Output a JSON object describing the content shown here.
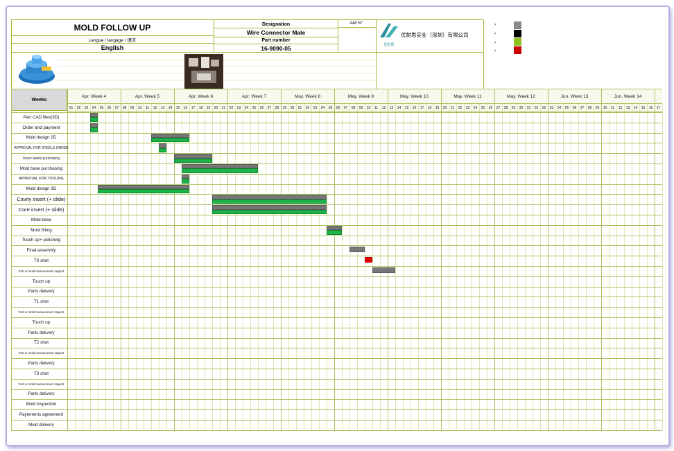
{
  "header": {
    "title": "MOLD FOLLOW UP",
    "language_label": "Langue / langage / 语言",
    "language_value": "English",
    "designation_label": "Designation",
    "designation_value": "Wire Connector Male",
    "am_label": "AM N°",
    "part_number_label": "Part number",
    "part_number_value": "16-9090-05",
    "company_name": "优耐思实业（深圳）有限公司",
    "logo_caption": "优耐思"
  },
  "legend": {
    "colors": [
      "#888888",
      "#000000",
      "#8dc21f",
      "#cc0000"
    ]
  },
  "schedule": {
    "weeks_label": "Weeks",
    "weeks": [
      "Apr.  Week  4",
      "Apr.  Week  5",
      "Apr.  Week  6",
      "Apr.  Week  7",
      "May.  Week  8",
      "May.  Week  9",
      "May.  Week  10",
      "May.  Week  11",
      "May.  Week  12",
      "Jun.  Week  13",
      "Jun.  Week  14"
    ],
    "days": [
      "01",
      "02",
      "03",
      "04",
      "05",
      "06",
      "07",
      "08",
      "09",
      "10",
      "11",
      "12",
      "13",
      "14",
      "15",
      "16",
      "17",
      "18",
      "19",
      "20",
      "21",
      "22",
      "23",
      "24",
      "25",
      "26",
      "27",
      "28",
      "29",
      "30",
      "01",
      "02",
      "03",
      "04",
      "05",
      "06",
      "07",
      "08",
      "09",
      "10",
      "11",
      "12",
      "13",
      "14",
      "15",
      "16",
      "17",
      "18",
      "19",
      "20",
      "21",
      "22",
      "23",
      "24",
      "25",
      "26",
      "27",
      "28",
      "29",
      "30",
      "31",
      "01",
      "02",
      "03",
      "04",
      "05",
      "06",
      "07",
      "08",
      "09",
      "10",
      "11",
      "12",
      "13",
      "14",
      "15",
      "16",
      "17"
    ],
    "tasks": [
      "Part CAD files(3D)",
      "Order and payment",
      "Mold design 2D",
      "APPROVAL FOR STEELS ORDER",
      "Insert steels purchasing",
      "Mold base purchasing",
      "APPROVAL FOR TOOLING",
      "Mold design 3D",
      "Cavity insert (+ slide)",
      "Core insert (+ slide)",
      "Mold base",
      "Mold fitting",
      "Touch up+ polishing",
      "Final assembly",
      "T0 shot",
      "Part or mold measurement rapport",
      "Touch up",
      "Parts delivery",
      "T1 shot",
      "Part or mold measurement rapport",
      "Touch up",
      "Parts delivery",
      "T2 shot",
      "Part or mold measurement rapport",
      "Parts delivery",
      "T3 shot",
      "Part or mold measurement rapport",
      "Parts delivery",
      "Mold inspection",
      "Payements agreement",
      "Mold delivery"
    ],
    "bars": [
      {
        "task": 0,
        "start": 3,
        "end": 3,
        "color": "grey"
      },
      {
        "task": 0,
        "start": 3,
        "end": 3,
        "color": "green"
      },
      {
        "task": 1,
        "start": 3,
        "end": 3,
        "color": "grey"
      },
      {
        "task": 1,
        "start": 3,
        "end": 3,
        "color": "green"
      },
      {
        "task": 2,
        "start": 11,
        "end": 15,
        "color": "grey"
      },
      {
        "task": 2,
        "start": 11,
        "end": 15,
        "color": "green"
      },
      {
        "task": 3,
        "start": 12,
        "end": 12,
        "color": "grey"
      },
      {
        "task": 3,
        "start": 12,
        "end": 12,
        "color": "green"
      },
      {
        "task": 4,
        "start": 14,
        "end": 18,
        "color": "grey"
      },
      {
        "task": 4,
        "start": 14,
        "end": 18,
        "color": "green"
      },
      {
        "task": 5,
        "start": 15,
        "end": 24,
        "color": "grey"
      },
      {
        "task": 5,
        "start": 15,
        "end": 24,
        "color": "green"
      },
      {
        "task": 6,
        "start": 15,
        "end": 15,
        "color": "grey"
      },
      {
        "task": 6,
        "start": 15,
        "end": 15,
        "color": "green"
      },
      {
        "task": 7,
        "start": 4,
        "end": 15,
        "color": "grey"
      },
      {
        "task": 7,
        "start": 4,
        "end": 15,
        "color": "green"
      },
      {
        "task": 8,
        "start": 19,
        "end": 33,
        "color": "grey"
      },
      {
        "task": 8,
        "start": 19,
        "end": 33,
        "color": "green"
      },
      {
        "task": 9,
        "start": 19,
        "end": 33,
        "color": "grey"
      },
      {
        "task": 9,
        "start": 19,
        "end": 33,
        "color": "green"
      },
      {
        "task": 11,
        "start": 34,
        "end": 35,
        "color": "grey"
      },
      {
        "task": 11,
        "start": 34,
        "end": 35,
        "color": "green"
      },
      {
        "task": 13,
        "start": 37,
        "end": 38,
        "color": "grey"
      },
      {
        "task": 14,
        "start": 39,
        "end": 39,
        "color": "red"
      },
      {
        "task": 15,
        "start": 40,
        "end": 42,
        "color": "grey"
      }
    ]
  }
}
